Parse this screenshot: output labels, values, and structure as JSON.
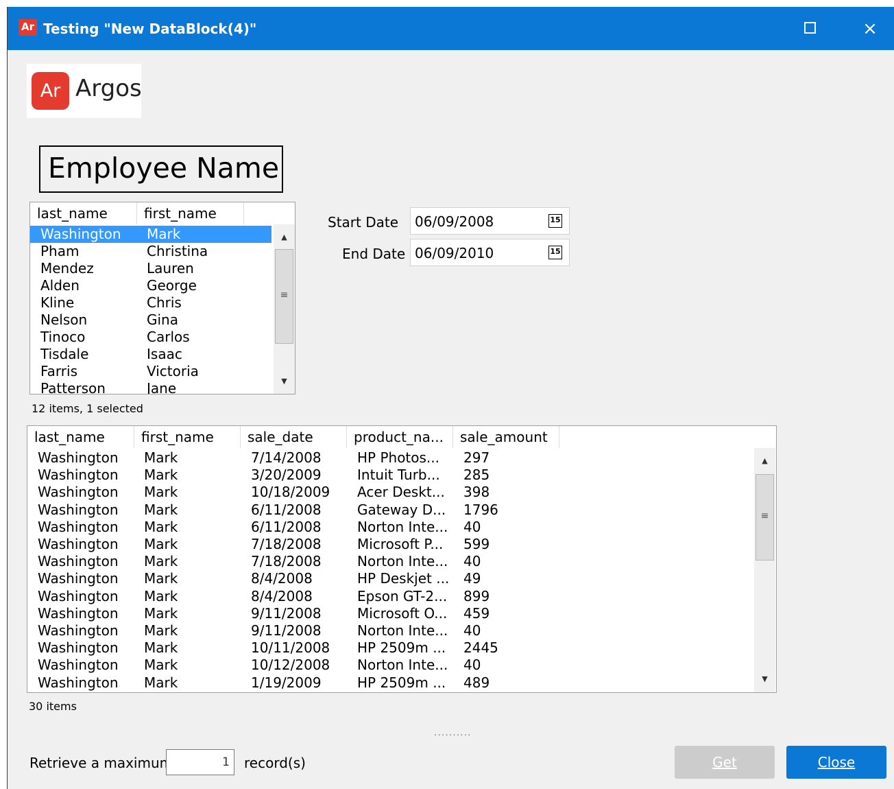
{
  "window": {
    "app_icon": "Ar",
    "title": "Testing \"New DataBlock(4)\"",
    "maximize_icon": "maximize-icon",
    "close_icon": "×"
  },
  "logo": {
    "mark": "Ar",
    "text": "Argos"
  },
  "employee_label": "Employee Name",
  "employee_list": {
    "columns": [
      "last_name",
      "first_name"
    ],
    "rows": [
      [
        "Washington",
        "Mark"
      ],
      [
        "Pham",
        "Christina"
      ],
      [
        "Mendez",
        "Lauren"
      ],
      [
        "Alden",
        "George"
      ],
      [
        "Kline",
        "Chris"
      ],
      [
        "Nelson",
        "Gina"
      ],
      [
        "Tinoco",
        "Carlos"
      ],
      [
        "Tisdale",
        "Isaac"
      ],
      [
        "Farris",
        "Victoria"
      ],
      [
        "Patterson",
        "Jane"
      ]
    ],
    "selected_index": 0,
    "status": "12 items, 1 selected"
  },
  "dates": {
    "start_label": "Start Date",
    "start_value": "06/09/2008",
    "end_label": "End Date",
    "end_value": "06/09/2010",
    "calendar_icon_text": "15"
  },
  "sales_grid": {
    "columns": [
      "last_name",
      "first_name",
      "sale_date",
      "product_na...",
      "sale_amount"
    ],
    "rows": [
      [
        "Washington",
        "Mark",
        "7/14/2008",
        "HP Photos...",
        "297"
      ],
      [
        "Washington",
        "Mark",
        "3/20/2009",
        "Intuit Turb...",
        "285"
      ],
      [
        "Washington",
        "Mark",
        "10/18/2009",
        "Acer Deskt...",
        "398"
      ],
      [
        "Washington",
        "Mark",
        "6/11/2008",
        "Gateway D...",
        "1796"
      ],
      [
        "Washington",
        "Mark",
        "6/11/2008",
        "Norton Inte...",
        "40"
      ],
      [
        "Washington",
        "Mark",
        "7/18/2008",
        "Microsoft P...",
        "599"
      ],
      [
        "Washington",
        "Mark",
        "7/18/2008",
        "Norton Inte...",
        "40"
      ],
      [
        "Washington",
        "Mark",
        "8/4/2008",
        "HP Deskjet ...",
        "49"
      ],
      [
        "Washington",
        "Mark",
        "8/4/2008",
        "Epson GT-2...",
        "899"
      ],
      [
        "Washington",
        "Mark",
        "9/11/2008",
        "Microsoft O...",
        "459"
      ],
      [
        "Washington",
        "Mark",
        "9/11/2008",
        "Norton Inte...",
        "40"
      ],
      [
        "Washington",
        "Mark",
        "10/11/2008",
        "HP 2509m ...",
        "2445"
      ],
      [
        "Washington",
        "Mark",
        "10/12/2008",
        "Norton Inte...",
        "40"
      ],
      [
        "Washington",
        "Mark",
        "1/19/2009",
        "HP 2509m ...",
        "489"
      ]
    ],
    "status": "30 items"
  },
  "footer": {
    "retrieve_label": "Retrieve a maximum",
    "retrieve_value": "1",
    "records_label": "record(s)",
    "get_label": "Get",
    "close_label": "Close"
  },
  "colors": {
    "titlebar": "#0a78d4",
    "accent_red": "#e53a2e",
    "selection": "#3399ff"
  }
}
